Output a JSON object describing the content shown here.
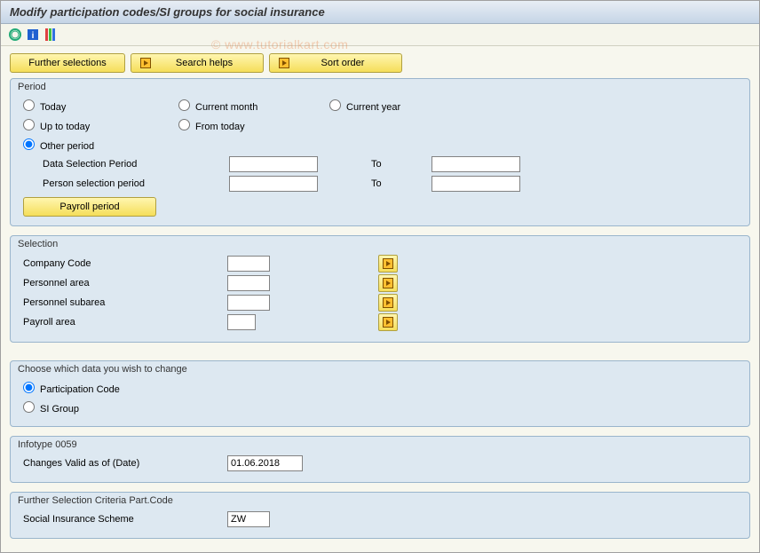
{
  "title": "Modify participation codes/SI groups for social insurance",
  "watermark": "© www.tutorialkart.com",
  "toolbar_buttons": {
    "further_selections": "Further selections",
    "search_helps": "Search helps",
    "sort_order": "Sort order"
  },
  "period": {
    "group_title": "Period",
    "radios": {
      "today": "Today",
      "up_to_today": "Up to today",
      "other_period": "Other period",
      "current_month": "Current month",
      "from_today": "From today",
      "current_year": "Current year"
    },
    "data_selection_label": "Data Selection Period",
    "data_selection_from": "",
    "data_selection_to_label": "To",
    "data_selection_to": "",
    "person_selection_label": "Person selection period",
    "person_selection_from": "",
    "person_selection_to_label": "To",
    "person_selection_to": "",
    "payroll_period_btn": "Payroll period"
  },
  "selection": {
    "group_title": "Selection",
    "company_code_label": "Company Code",
    "company_code": "",
    "personnel_area_label": "Personnel area",
    "personnel_area": "",
    "personnel_subarea_label": "Personnel subarea",
    "personnel_subarea": "",
    "payroll_area_label": "Payroll area",
    "payroll_area": ""
  },
  "choose": {
    "group_title": "Choose which data you wish to change",
    "participation_code": "Participation Code",
    "si_group": "SI Group"
  },
  "infotype": {
    "group_title": "Infotype 0059",
    "changes_valid_label": "Changes Valid as of (Date)",
    "changes_valid_value": "01.06.2018"
  },
  "further": {
    "group_title": "Further Selection Criteria Part.Code",
    "sis_label": "Social Insurance Scheme",
    "sis_value": "ZW"
  }
}
